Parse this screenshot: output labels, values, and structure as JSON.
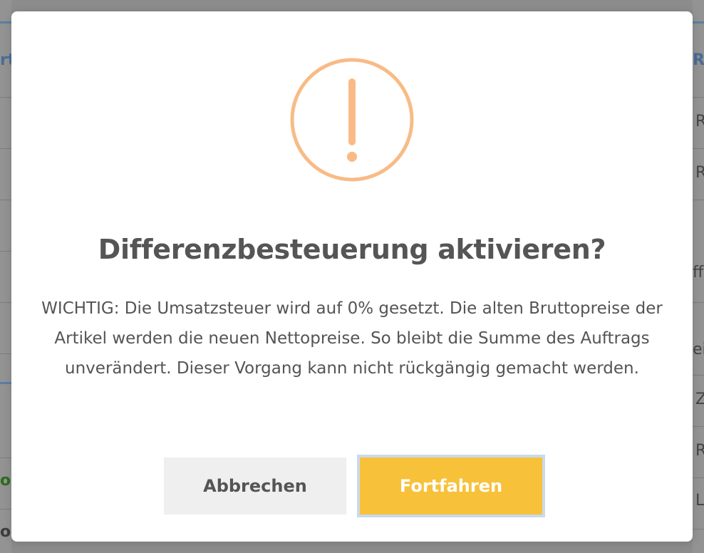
{
  "background": {
    "left_fragments": [
      "rt",
      "oo",
      "oo"
    ],
    "right_fragments": [
      "Re",
      "R",
      "R",
      "ffe",
      "ein",
      "Z",
      "R",
      "L"
    ]
  },
  "dialog": {
    "icon": "exclamation-circle-icon",
    "icon_color": "#f8bb86",
    "title": "Differenzbesteuerung aktivieren?",
    "text": "WICHTIG: Die Umsatzsteuer wird auf 0% gesetzt. Die alten Bruttopreise der Artikel werden die neuen Nettopreise. So bleibt die Summe des Auftrags unverändert. Dieser Vorgang kann nicht rückgängig gemacht werden.",
    "cancel_label": "Abbrechen",
    "confirm_label": "Fortfahren",
    "confirm_color": "#f8c13a",
    "cancel_color": "#efefef"
  }
}
